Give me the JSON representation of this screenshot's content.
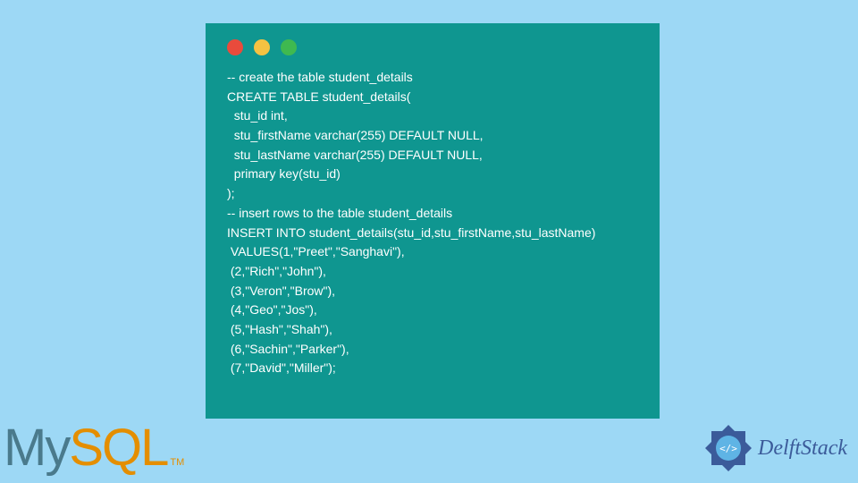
{
  "code": {
    "lines": "-- create the table student_details\nCREATE TABLE student_details(\n  stu_id int,\n  stu_firstName varchar(255) DEFAULT NULL,\n  stu_lastName varchar(255) DEFAULT NULL,\n  primary key(stu_id)\n);\n-- insert rows to the table student_details\nINSERT INTO student_details(stu_id,stu_firstName,stu_lastName)\n VALUES(1,\"Preet\",\"Sanghavi\"),\n (2,\"Rich\",\"John\"),\n (3,\"Veron\",\"Brow\"),\n (4,\"Geo\",\"Jos\"),\n (5,\"Hash\",\"Shah\"),\n (6,\"Sachin\",\"Parker\"),\n (7,\"David\",\"Miller\");"
  },
  "logos": {
    "mysql_my": "My",
    "mysql_sql": "SQL",
    "mysql_tm": "TM",
    "delft": "DelftStack"
  }
}
